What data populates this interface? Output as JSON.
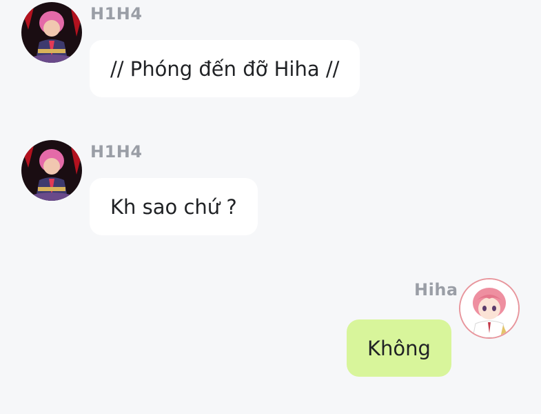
{
  "messages": [
    {
      "sender": "H1H4",
      "text": "// Phóng đến đỡ Hiha //",
      "direction": "incoming",
      "avatar_icon": "anime-boy-red-avatar"
    },
    {
      "sender": "H1H4",
      "text": "Kh sao chứ ?",
      "direction": "incoming",
      "avatar_icon": "anime-boy-red-avatar"
    },
    {
      "sender": "Hiha",
      "text": "Không",
      "direction": "outgoing",
      "avatar_icon": "anime-pink-hair-avatar"
    }
  ],
  "colors": {
    "background": "#f6f7f9",
    "incoming_bubble": "#ffffff",
    "outgoing_bubble": "#d8f59b",
    "sender_name": "#9a9ea6",
    "avatar_border": "#e8959c"
  }
}
